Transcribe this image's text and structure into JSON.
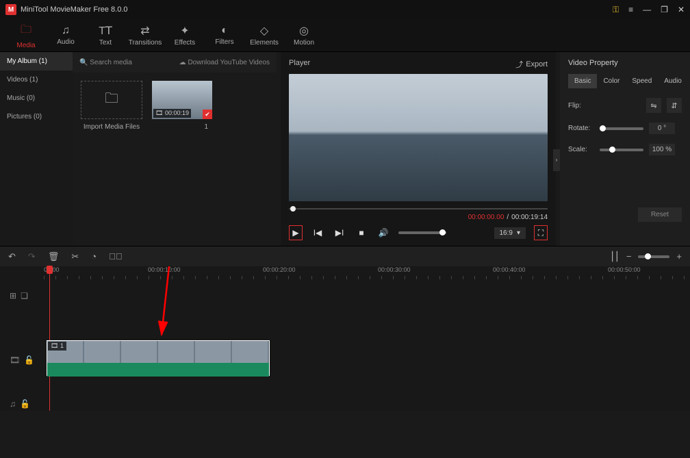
{
  "app": {
    "title": "MiniTool MovieMaker Free 8.0.0"
  },
  "toolbar": {
    "items": [
      {
        "label": "Media",
        "icon": "🗀"
      },
      {
        "label": "Audio",
        "icon": "♫"
      },
      {
        "label": "Text",
        "icon": "T𝖳"
      },
      {
        "label": "Transitions",
        "icon": "⇄"
      },
      {
        "label": "Effects",
        "icon": "✦"
      },
      {
        "label": "Filters",
        "icon": "◐"
      },
      {
        "label": "Elements",
        "icon": "◇"
      },
      {
        "label": "Motion",
        "icon": "◎"
      }
    ]
  },
  "albums": {
    "items": [
      {
        "label": "My Album (1)"
      },
      {
        "label": "Videos (1)"
      },
      {
        "label": "Music (0)"
      },
      {
        "label": "Pictures (0)"
      }
    ]
  },
  "media_top": {
    "search": "Search media",
    "download": "Download YouTube Videos"
  },
  "import": {
    "label": "Import Media Files"
  },
  "clip": {
    "duration": "00:00:19",
    "index": "1",
    "film_icon": "🎞"
  },
  "player": {
    "title": "Player",
    "export": "Export",
    "time_current": "00:00:00.00",
    "time_total": "00:00:19:14",
    "sep": " / ",
    "ratio": "16:9"
  },
  "props": {
    "title": "Video Property",
    "tabs": [
      "Basic",
      "Color",
      "Speed",
      "Audio"
    ],
    "flip_label": "Flip:",
    "rotate_label": "Rotate:",
    "rotate_value": "0 °",
    "scale_label": "Scale:",
    "scale_value": "100 %",
    "reset": "Reset"
  },
  "ruler": {
    "marks": [
      "00:00",
      "00:00:10:00",
      "00:00:20:00",
      "00:00:30:00",
      "00:00:40:00",
      "00:00:50:00"
    ]
  },
  "track_clip": {
    "badge_icon": "🎞",
    "badge_num": "1"
  }
}
